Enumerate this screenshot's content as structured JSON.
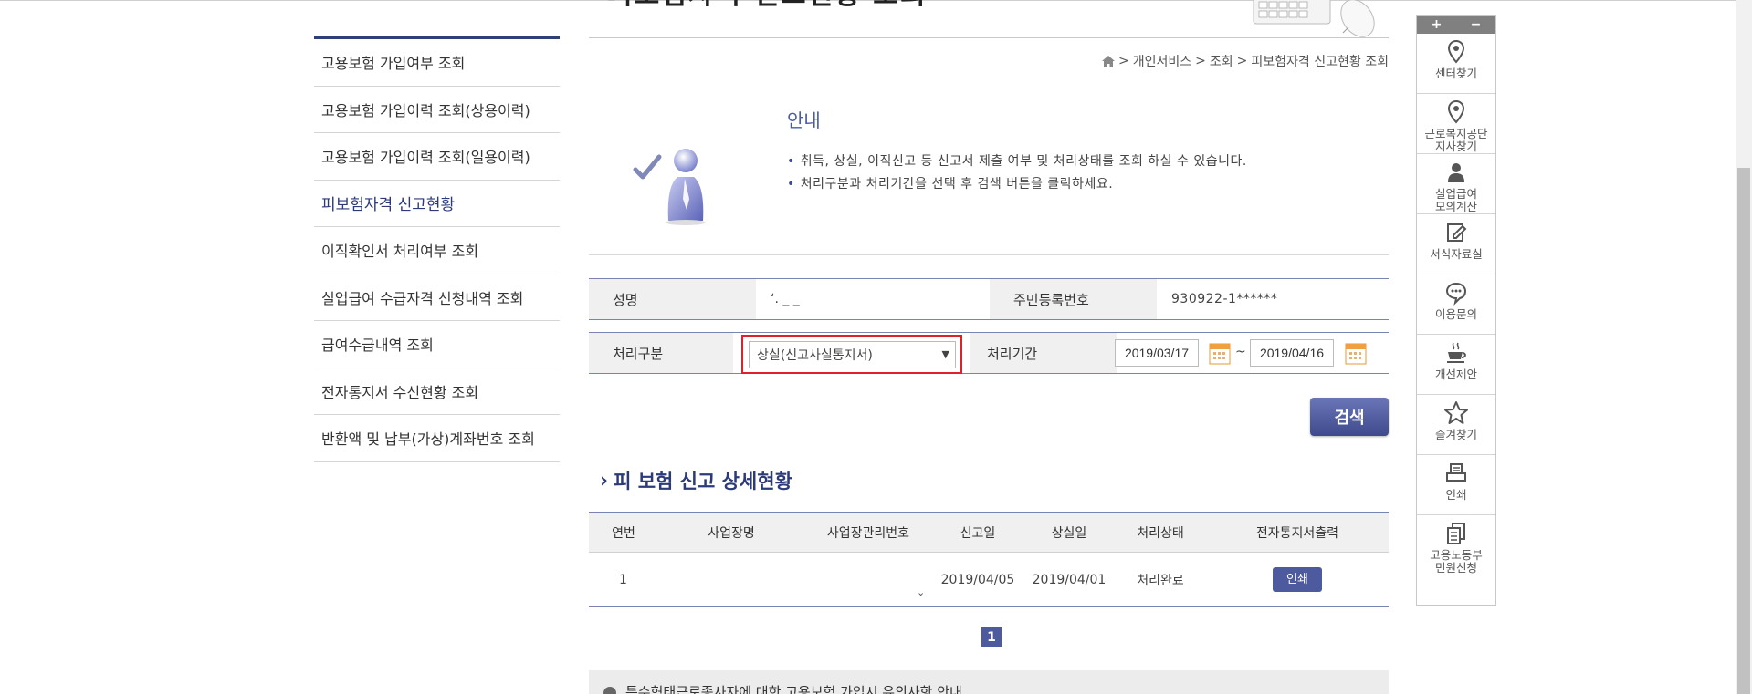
{
  "header": {
    "page_title_fragment": "피보험자격 신고현황 조회"
  },
  "breadcrumb": {
    "home_icon": "home-icon",
    "items": [
      "개인서비스",
      "조회",
      "피보험자격 신고현황 조회"
    ],
    "separator": ">"
  },
  "sidebar": {
    "items": [
      {
        "label": "고용보험 가입여부 조회"
      },
      {
        "label": "고용보험 가입이력 조회(상용이력)"
      },
      {
        "label": "고용보험 가입이력 조회(일용이력)"
      },
      {
        "label": "피보험자격 신고현황"
      },
      {
        "label": "이직확인서 처리여부 조회"
      },
      {
        "label": "실업급여 수급자격 신청내역 조회"
      },
      {
        "label": "급여수급내역 조회"
      },
      {
        "label": "전자통지서 수신현황 조회"
      },
      {
        "label": "반환액 및 납부(가상)계좌번호 조회"
      }
    ],
    "active_index": 3
  },
  "info": {
    "title": "안내",
    "lines": [
      "취득, 상실, 이직신고 등 신고서 제출 여부 및 처리상태를 조회 하실 수 있습니다.",
      "처리구분과 처리기간을 선택 후 검색 버튼을 클릭하세요."
    ]
  },
  "form": {
    "name_label": "성명",
    "name_value": "ʻ. _ _",
    "rrn_label": "주민등록번호",
    "rrn_value": "930922-1******",
    "type_label": "처리구분",
    "type_selected": "상실(신고사실통지서)",
    "period_label": "처리기간",
    "date_from": "2019/03/17",
    "date_to": "2019/04/16",
    "tilde": "~",
    "search_label": "검색"
  },
  "result": {
    "section_title": "피 보험 신고 상세현황",
    "columns": [
      "연번",
      "사업장명",
      "사업장관리번호",
      "신고일",
      "상실일",
      "처리상태",
      "전자통지서출력"
    ],
    "rows": [
      {
        "no": "1",
        "workplace": "",
        "mgmt_no": "",
        "report_date": "2019/04/05",
        "loss_date": "2019/04/01",
        "status": "처리완료",
        "print_label": "인쇄"
      }
    ],
    "page": "1"
  },
  "notice": {
    "text": "특수형태근로종사자에 대한 고용보험 가입시 유의사항 안내"
  },
  "quickmenu": {
    "plus": "+",
    "minus": "−",
    "items": [
      {
        "label": "센터찾기",
        "icon": "map-pin-icon"
      },
      {
        "label": "근로복지공단\n지사찾기",
        "icon": "map-pin-icon"
      },
      {
        "label": "실업급여\n모의계산",
        "icon": "user-icon"
      },
      {
        "label": "서식자료실",
        "icon": "edit-icon"
      },
      {
        "label": "이용문의",
        "icon": "chat-icon"
      },
      {
        "label": "개선제안",
        "icon": "coffee-icon"
      },
      {
        "label": "즐겨찾기",
        "icon": "star-icon"
      },
      {
        "label": "인쇄",
        "icon": "printer-icon"
      },
      {
        "label": "고용노동부\n민원신청",
        "icon": "documents-icon"
      }
    ]
  },
  "colors": {
    "accent": "#2c3a7a",
    "button": "#4e5a9e",
    "highlight": "#e0212b"
  }
}
